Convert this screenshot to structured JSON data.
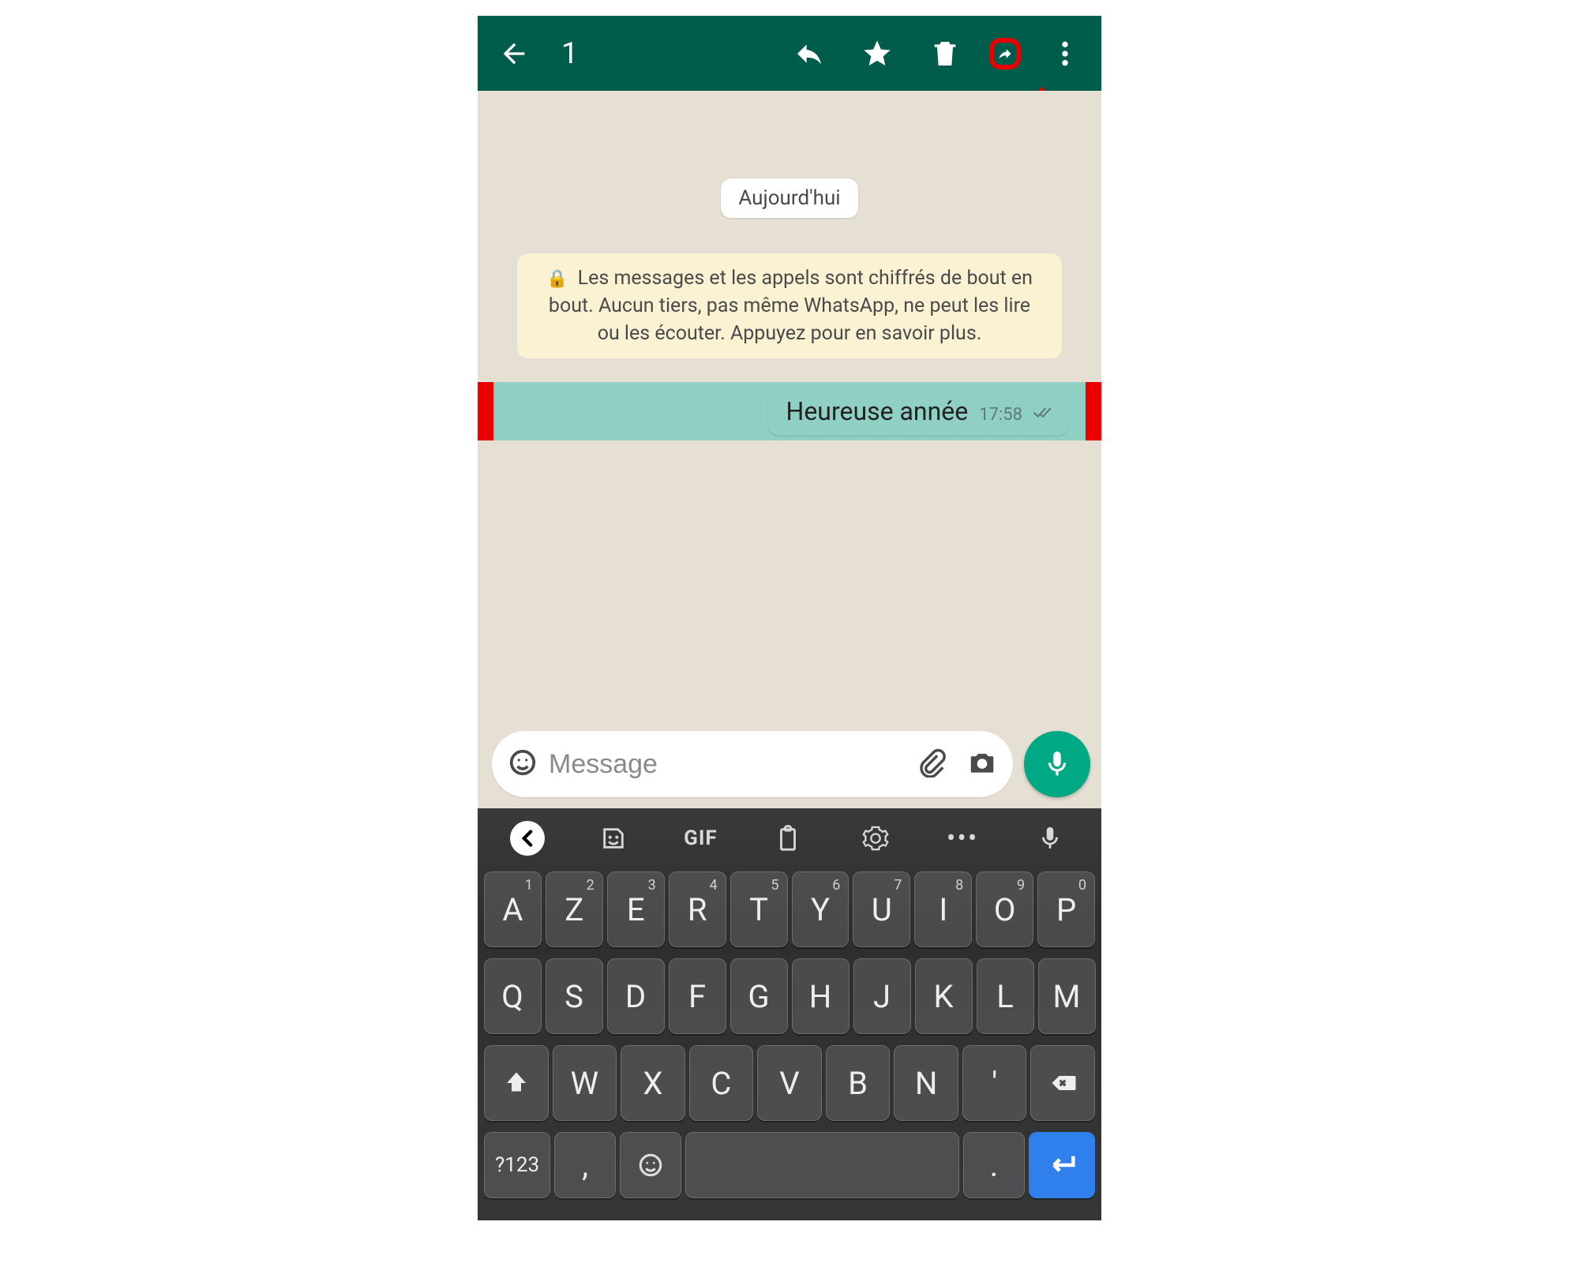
{
  "toolbar": {
    "selected_count": "1"
  },
  "chat": {
    "date_label": "Aujourd'hui",
    "e2e_notice": "Les messages et les appels sont chiffrés de bout en bout. Aucun tiers, pas même WhatsApp, ne peut les lire ou les écouter. Appuyez pour en savoir plus.",
    "messages": [
      {
        "text": "Heureuse année",
        "time": "17:58",
        "selected": true,
        "outgoing": true,
        "status": "read"
      }
    ]
  },
  "compose": {
    "placeholder": "Message",
    "value": ""
  },
  "keyboard": {
    "layout": "AZERTY",
    "toolbar_gif_label": "GIF",
    "row1": [
      {
        "k": "A",
        "s": "1"
      },
      {
        "k": "Z",
        "s": "2"
      },
      {
        "k": "E",
        "s": "3"
      },
      {
        "k": "R",
        "s": "4"
      },
      {
        "k": "T",
        "s": "5"
      },
      {
        "k": "Y",
        "s": "6"
      },
      {
        "k": "U",
        "s": "7"
      },
      {
        "k": "I",
        "s": "8"
      },
      {
        "k": "O",
        "s": "9"
      },
      {
        "k": "P",
        "s": "0"
      }
    ],
    "row2": [
      "Q",
      "S",
      "D",
      "F",
      "G",
      "H",
      "J",
      "K",
      "L",
      "M"
    ],
    "row3": [
      "W",
      "X",
      "C",
      "V",
      "B",
      "N",
      "'"
    ],
    "sym_label": "?123",
    "comma": ",",
    "dot": "."
  }
}
